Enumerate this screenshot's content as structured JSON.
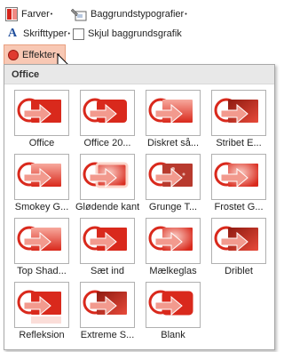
{
  "ribbon": {
    "farver": "Farver",
    "baggrund": "Baggrundstypografier",
    "skrifttyper": "Skrifttyper",
    "skjul": "Skjul baggrundsgrafik",
    "effekter": "Effekter"
  },
  "panel": {
    "header": "Office",
    "items": [
      {
        "label": "Office",
        "style": "plain"
      },
      {
        "label": "Office 20...",
        "style": "light"
      },
      {
        "label": "Diskret så...",
        "style": "gradient"
      },
      {
        "label": "Stribet E...",
        "style": "dark"
      },
      {
        "label": "Smokey G...",
        "style": "smokey"
      },
      {
        "label": "Glødende kant",
        "style": "glow"
      },
      {
        "label": "Grunge T...",
        "style": "grunge"
      },
      {
        "label": "Frostet G...",
        "style": "frost"
      },
      {
        "label": "Top Shad...",
        "style": "shadow"
      },
      {
        "label": "Sæt ind",
        "style": "inset"
      },
      {
        "label": "Mælkeglas",
        "style": "milk"
      },
      {
        "label": "Driblet",
        "style": "driblet"
      },
      {
        "label": "Refleksion",
        "style": "reflect"
      },
      {
        "label": "Extreme S...",
        "style": "extreme"
      },
      {
        "label": "Blank",
        "style": "blank"
      }
    ]
  },
  "colors": {
    "red": "#d9291c",
    "light_red": "#f49b8f",
    "selected_bg": "#f8c8b4"
  }
}
